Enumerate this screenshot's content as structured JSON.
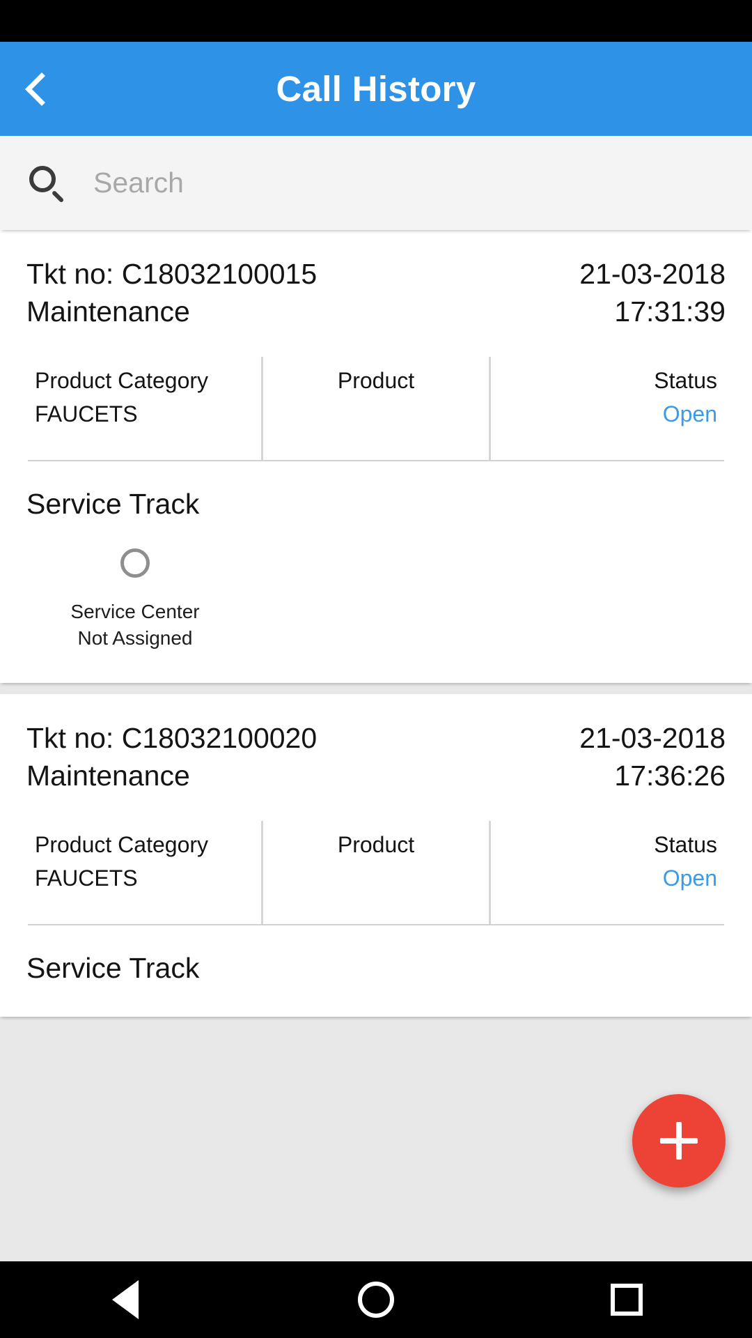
{
  "statusbar": {
    "present": true
  },
  "appbar": {
    "title": "Call History",
    "back_icon": "chevron-left-icon",
    "background_color": "#2e93e6"
  },
  "search": {
    "icon": "search-icon",
    "placeholder": "Search",
    "value": ""
  },
  "colors": {
    "accent_blue": "#2e93e6",
    "status_open": "#3d9ae8",
    "fab_red": "#ed4337",
    "divider": "#d6d6d6"
  },
  "labels": {
    "ticket_prefix": "Tkt no: ",
    "product_category": "Product Category",
    "product": "Product",
    "status": "Status",
    "service_track": "Service Track"
  },
  "tickets": [
    {
      "ticket_no": "Tkt no: C18032100015",
      "type": "Maintenance",
      "date": "21-03-2018",
      "time": "17:31:39",
      "product_category_label": "Product Category",
      "product_category_value": "FAUCETS",
      "product_label": "Product",
      "product_value": "",
      "status_label": "Status",
      "status_value": "Open",
      "service_track_title": "Service Track",
      "track_node_line1": "Service Center",
      "track_node_line2": "Not Assigned"
    },
    {
      "ticket_no": "Tkt no: C18032100020",
      "type": "Maintenance",
      "date": "21-03-2018",
      "time": "17:36:26",
      "product_category_label": "Product Category",
      "product_category_value": "FAUCETS",
      "product_label": "Product",
      "product_value": "",
      "status_label": "Status",
      "status_value": "Open",
      "service_track_title": "Service Track"
    }
  ],
  "fab": {
    "icon": "plus-icon",
    "label": "+"
  },
  "navbar": {
    "back": "triangle-back-icon",
    "home": "circle-home-icon",
    "recents": "square-recents-icon"
  }
}
